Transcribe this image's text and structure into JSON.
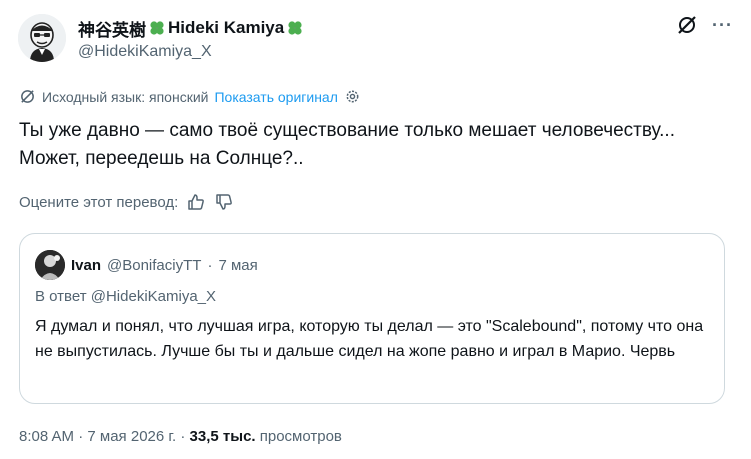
{
  "author": {
    "display_name": "神谷英樹",
    "display_name_latin": "Hideki Kamiya",
    "handle": "@HidekiKamiya_X"
  },
  "translation": {
    "source_label": "Исходный язык: японский",
    "show_original": "Показать оригинал"
  },
  "tweet": {
    "text": "Ты уже давно — само твоё существование только мешает человечеству... Может, переедешь на Солнце?.."
  },
  "rate": {
    "label": "Оцените этот перевод:"
  },
  "quote": {
    "name": "Ivan",
    "handle": "@BonifaciyTT",
    "separator": "·",
    "date": "7 мая",
    "reply_to": "В ответ @HidekiKamiya_X",
    "text": "Я думал и понял, что лучшая игра, которую ты делал — это \"Scalebound\", потому что она не выпустилась. Лучше бы ты и дальше сидел на жопе равно и играл в Марио. Червь"
  },
  "footer": {
    "time": "8:08 AM",
    "separator": "·",
    "date": "7 мая 2026 г.",
    "views_count": "33,5 тыс.",
    "views_label": "просмотров"
  },
  "colors": {
    "accent": "#1d9bf0",
    "muted": "#536471",
    "text": "#0f1419",
    "border": "#cfd9de",
    "clover": "#4caf50"
  },
  "icons": [
    "avatar-doodle",
    "clover-icon",
    "grok-icon",
    "more-icon",
    "translate-icon",
    "settings-gear-icon",
    "thumbs-up-icon",
    "thumbs-down-icon"
  ]
}
